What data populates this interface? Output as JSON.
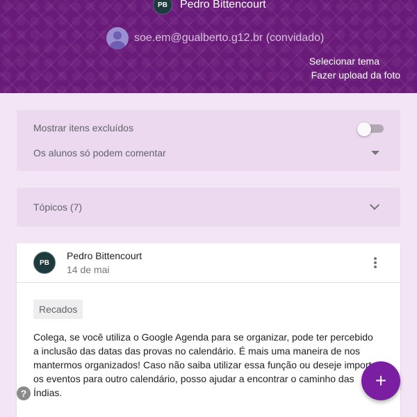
{
  "header": {
    "class_logo_text": "PB",
    "class_name": "Pedro Bittencourt",
    "guest_email": "soe.em@gualberto.g12.br (convidado)",
    "select_theme": "Selecionar tema",
    "upload_photo": "Fazer upload da foto",
    "banner_color": "#6a1b7a"
  },
  "settings": {
    "show_deleted_label": "Mostrar itens excluídos",
    "show_deleted_on": false,
    "comment_permission": "Os alunos só podem comentar"
  },
  "topics": {
    "label": "Tópicos (7)"
  },
  "post": {
    "author_initials": "PB",
    "author": "Pedro Bittencourt",
    "date": "14 de mai",
    "topic": "Recados",
    "body": "Colega, se você utiliza o Google Agenda para se organizar, pode ter percebido a inclusão das datas das provas no calendário. É mais uma maneira de nos mantermos organizados! Caso não saiba utilizar essa função ou deseje importar os eventos para outro calendário, posso ajudar a encontrar o caminho das Índias."
  },
  "fab": {
    "icon": "plus-icon",
    "symbol": "+",
    "color": "#7b1fa2"
  },
  "help": {
    "icon": "help-icon",
    "symbol": "?"
  }
}
